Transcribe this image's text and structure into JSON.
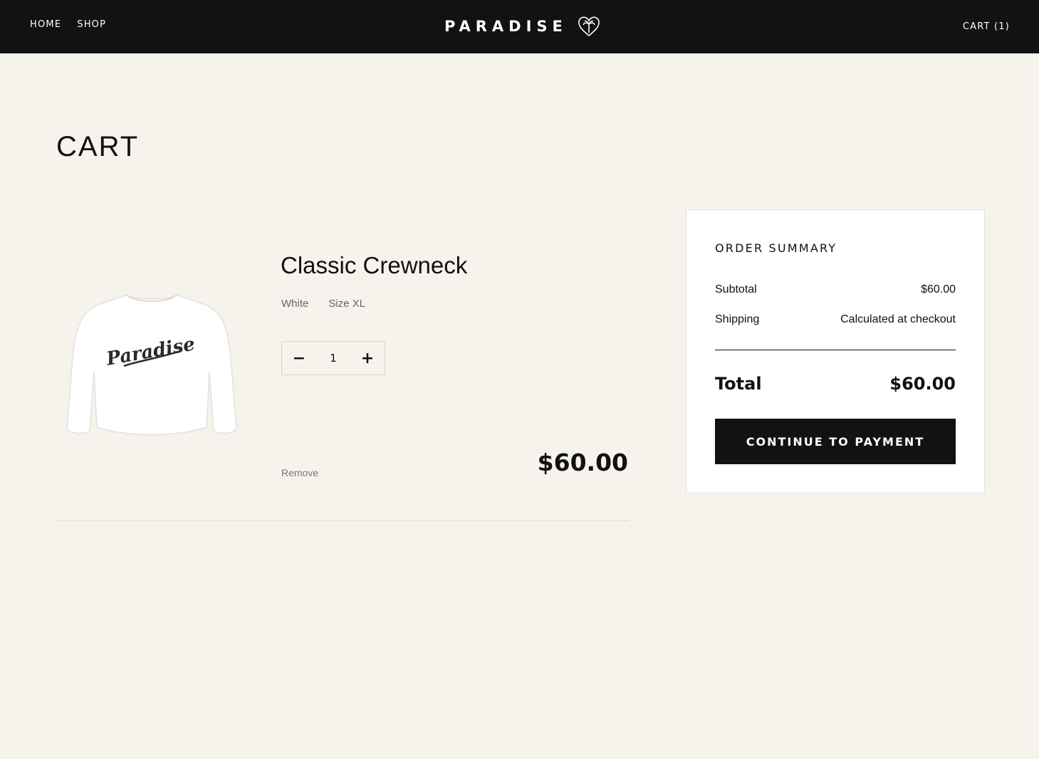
{
  "header": {
    "nav": [
      "HOME",
      "SHOP"
    ],
    "brand": "PARADISE",
    "brand_icon": "palm-heart-icon",
    "cart_label": "CART (1)"
  },
  "page": {
    "title": "CART"
  },
  "item": {
    "image_icon": "crewneck-sweatshirt-image",
    "image_text": "Paradise",
    "name": "Classic Crewneck",
    "color": "White",
    "size": "Size XL",
    "quantity": "1",
    "decrement": "−",
    "increment": "+",
    "remove_label": "Remove",
    "price": "$60.00"
  },
  "summary": {
    "title": "ORDER SUMMARY",
    "subtotal_label": "Subtotal",
    "subtotal_value": "$60.00",
    "shipping_label": "Shipping",
    "shipping_value": "Calculated at checkout",
    "total_label": "Total",
    "total_value": "$60.00",
    "button_label": "CONTINUE TO PAYMENT"
  },
  "colors": {
    "header_bg": "#121212",
    "page_bg": "#f6f3ec",
    "button_bg": "#121212"
  }
}
